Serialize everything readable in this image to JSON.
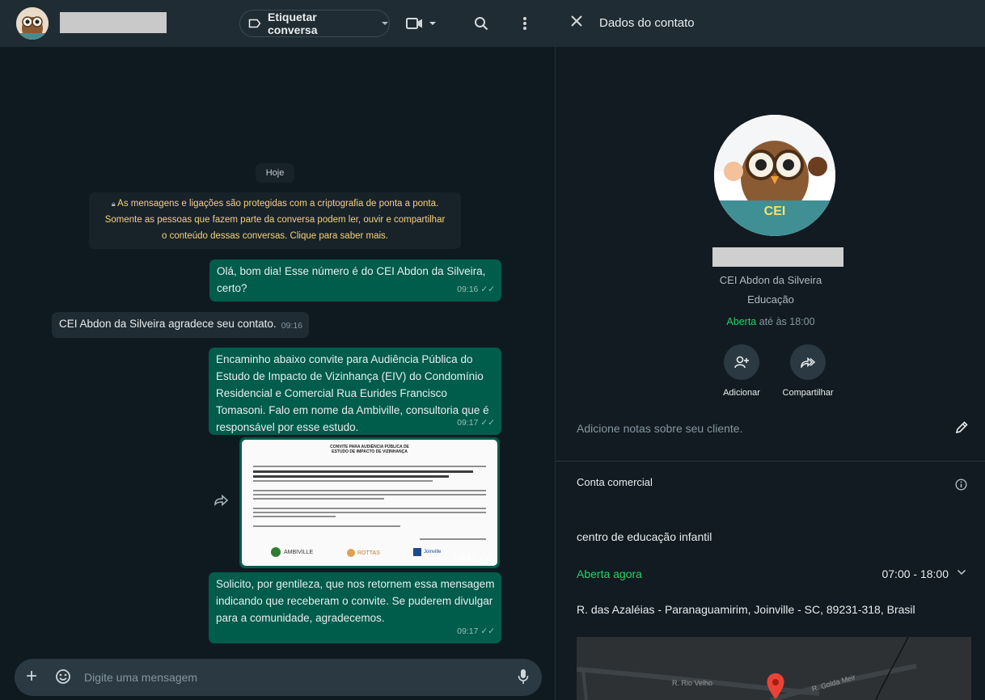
{
  "chat": {
    "header": {
      "label_button": "Etiquetar conversa"
    },
    "date_chip": "Hoje",
    "encryption_notice": {
      "line1": "As mensagens e ligações são protegidas com a criptografia de ponta a ponta.",
      "line2": "Somente as pessoas que fazem parte da conversa podem ler, ouvir e compartilhar",
      "line3": "o conteúdo dessas conversas. Clique para saber mais."
    },
    "messages": [
      {
        "direction": "out",
        "text": "Olá, bom dia! Esse número é do CEI Abdon da Silveira, certo?",
        "time": "09:16"
      },
      {
        "direction": "in",
        "text": "CEI Abdon da Silveira agradece seu contato.",
        "time": "09:16"
      },
      {
        "direction": "out",
        "text": "Encaminho abaixo convite para Audiência Pública do Estudo de Impacto de Vizinhança (EIV) do Condomínio Residencial e Comercial Rua Eurides Francisco Tomasoni. Falo em nome da Ambiville, consultoria que é responsável por esse estudo.",
        "time": "09:17"
      },
      {
        "direction": "out",
        "type": "image",
        "time": "09:17",
        "doc_title_1": "CONVITE PARA AUDIÊNCIA PÚBLICA DE",
        "doc_title_2": "ESTUDO DE IMPACTO DE VIZINHANÇA",
        "doc_logos": [
          "AMBIVILLE",
          "ROTTAS",
          "Joinville"
        ]
      },
      {
        "direction": "out",
        "text": "Solicito, por gentileza, que nos retornem essa mensagem indicando que receberam o convite. Se puderem divulgar para a comunidade, agradecemos.",
        "time": "09:17"
      }
    ],
    "composer": {
      "placeholder": "Digite uma mensagem"
    }
  },
  "contact": {
    "header_title": "Dados do contato",
    "avatar_text": "CEI",
    "business_name": "CEI Abdon da Silveira",
    "category_short": "Educação",
    "status_open": "Aberta",
    "status_until": "até às 18:00",
    "actions": [
      {
        "label": "Adicionar",
        "icon": "add-person-icon"
      },
      {
        "label": "Compartilhar",
        "icon": "share-icon"
      }
    ],
    "notes_placeholder": "Adicione notas sobre seu cliente.",
    "section_title": "Conta comercial",
    "category": "centro de educação infantil",
    "open_now": "Aberta agora",
    "hours": "07:00 - 18:00",
    "address": "R. das Azaléias - Paranaguamirim, Joinville - SC, 89231-318, Brasil",
    "map_labels": [
      "R. Rio Velho",
      "R. Golda Meir"
    ]
  },
  "colors": {
    "outgoing_bubble": "#005c4b",
    "incoming_bubble": "#202c33",
    "open_green": "#25d366"
  }
}
